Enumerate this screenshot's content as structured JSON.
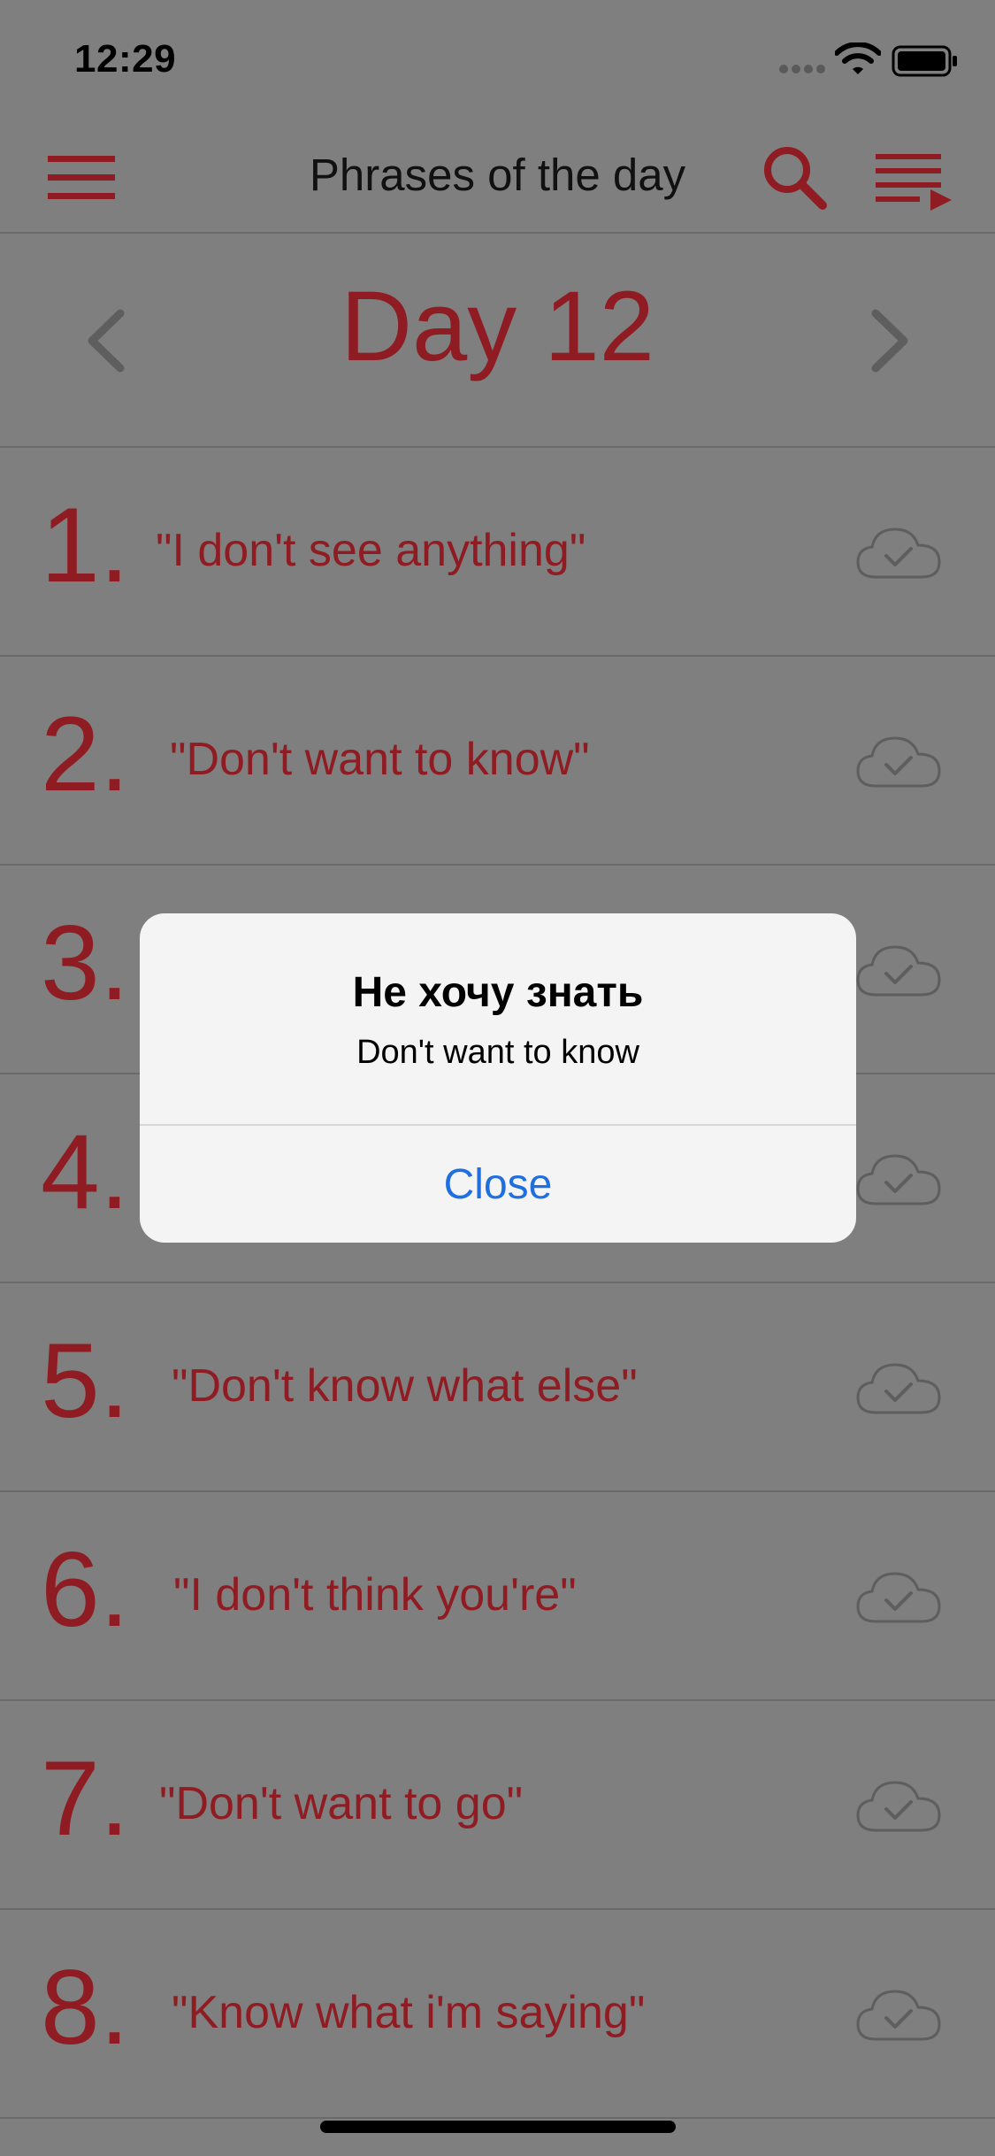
{
  "status_bar": {
    "time": "12:29"
  },
  "nav": {
    "title": "Phrases of the day",
    "icons": [
      "menu-icon",
      "search-icon",
      "playlist-play-icon"
    ]
  },
  "day": {
    "label": "Day 12"
  },
  "phrases": [
    {
      "number": "1.",
      "text": "\"I don't see anything\""
    },
    {
      "number": "2.",
      "text": "\"Don't want to know\""
    },
    {
      "number": "3.",
      "text": ""
    },
    {
      "number": "4.",
      "text": ""
    },
    {
      "number": "5.",
      "text": "\"Don't know what else\""
    },
    {
      "number": "6.",
      "text": "\"I don't think you're\""
    },
    {
      "number": "7.",
      "text": "\"Don't want to go\""
    },
    {
      "number": "8.",
      "text": "\"Know what i'm saying\""
    }
  ],
  "alert": {
    "title": "Не хочу знать",
    "message": "Don't want to know",
    "close_label": "Close"
  },
  "colors": {
    "accent": "#8f1c22",
    "dim_overlay": "#7f7f7f",
    "link_blue": "#1f6fe0"
  }
}
